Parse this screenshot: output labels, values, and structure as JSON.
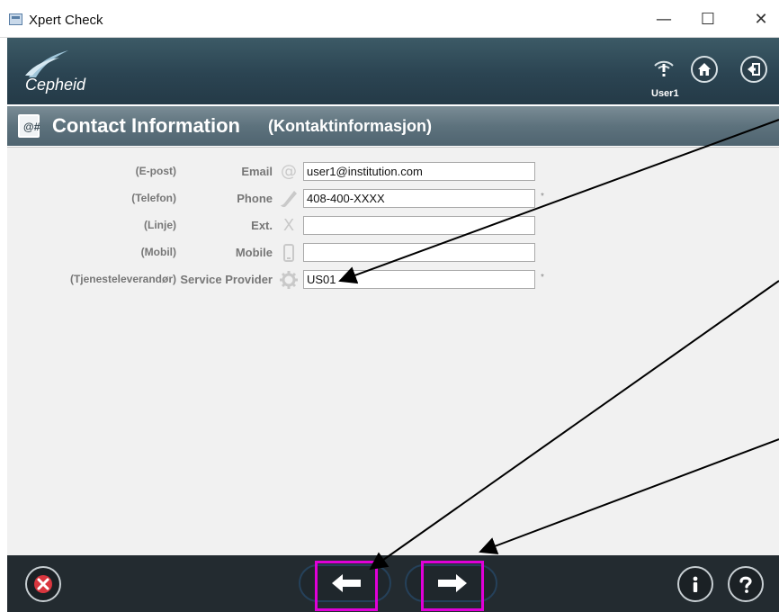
{
  "window": {
    "title": "Xpert Check",
    "controls": {
      "minimize": "—",
      "maximize": "☐",
      "close": "✕"
    }
  },
  "header": {
    "logo_text": "Cepheid",
    "user_label": "User1",
    "icons": [
      "warning-icon",
      "home-icon",
      "logout-icon"
    ]
  },
  "page": {
    "title": "Contact Information",
    "title_local": "(Kontaktinformasjon)"
  },
  "form": {
    "fields": [
      {
        "local_label": "(E-post)",
        "label": "Email",
        "icon": "at-icon",
        "value": "user1@institution.com",
        "required": ""
      },
      {
        "local_label": "(Telefon)",
        "label": "Phone",
        "icon": "phone-icon",
        "value": "408-400-XXXX",
        "required": "*"
      },
      {
        "local_label": "(Linje)",
        "label": "Ext.",
        "icon": "extension-icon",
        "value": "",
        "required": ""
      },
      {
        "local_label": "(Mobil)",
        "label": "Mobile",
        "icon": "mobile-icon",
        "value": "",
        "required": ""
      },
      {
        "local_label": "(Tjenesteleverandør)",
        "label": "Service Provider",
        "icon": "gear-icon",
        "value": "US01",
        "required": "*"
      }
    ]
  },
  "footer": {
    "buttons": [
      "cancel-icon",
      "back-arrow-icon",
      "next-arrow-icon",
      "info-icon",
      "help-icon"
    ]
  },
  "colors": {
    "header_bg": "#2b4452",
    "title_bar_bg": "#5d727d",
    "content_bg": "#f1f1f1",
    "footer_bg": "#232b30",
    "highlight": "#e000d8",
    "cancel_red": "#d9363e"
  }
}
